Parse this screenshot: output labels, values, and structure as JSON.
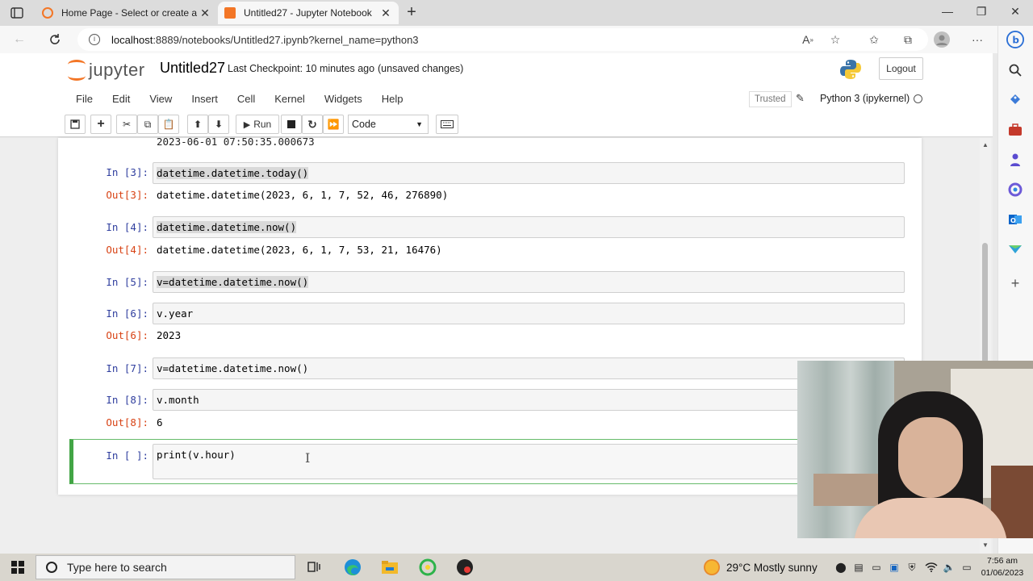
{
  "browser": {
    "tabs": [
      {
        "label": "Home Page - Select or create a n",
        "active": false
      },
      {
        "label": "Untitled27 - Jupyter Notebook",
        "active": true
      }
    ],
    "url_host": "localhost",
    "url_rest": ":8889/notebooks/Untitled27.ipynb?kernel_name=python3"
  },
  "jupyter": {
    "logo_text": "jupyter",
    "notebook_title": "Untitled27",
    "checkpoint": "Last Checkpoint: 10 minutes ago",
    "unsaved": "(unsaved changes)",
    "logout_label": "Logout",
    "menu": [
      "File",
      "Edit",
      "View",
      "Insert",
      "Cell",
      "Kernel",
      "Widgets",
      "Help"
    ],
    "trusted_label": "Trusted",
    "kernel_name": "Python 3 (ipykernel)",
    "toolbar": {
      "run_label": "Run",
      "cell_type": "Code"
    }
  },
  "notebook": {
    "partial_output": "2023-06-01 07:50:35.000673",
    "cells": [
      {
        "in_prompt": "In [3]:",
        "code": "datetime.datetime.today()",
        "out_prompt": "Out[3]:",
        "output": "datetime.datetime(2023, 6, 1, 7, 52, 46, 276890)"
      },
      {
        "in_prompt": "In [4]:",
        "code": "datetime.datetime.now()",
        "out_prompt": "Out[4]:",
        "output": "datetime.datetime(2023, 6, 1, 7, 53, 21, 16476)"
      },
      {
        "in_prompt": "In [5]:",
        "code": "v=datetime.datetime.now()"
      },
      {
        "in_prompt": "In [6]:",
        "code": "v.year",
        "out_prompt": "Out[6]:",
        "output": "2023"
      },
      {
        "in_prompt": "In [7]:",
        "code": "v=datetime.datetime.now()"
      },
      {
        "in_prompt": "In [8]:",
        "code": "v.month",
        "out_prompt": "Out[8]:",
        "output": "6"
      },
      {
        "in_prompt": "In [ ]:",
        "code": "print(v.hour)"
      }
    ]
  },
  "taskbar": {
    "search_placeholder": "Type here to search",
    "weather": "29°C  Mostly sunny",
    "time": "7:56 am",
    "date": "01/06/2023"
  },
  "colors": {
    "jupyter_orange": "#f37626",
    "in_prompt": "#303f9f",
    "out_prompt": "#d84315",
    "selected_cell": "#42a545"
  }
}
